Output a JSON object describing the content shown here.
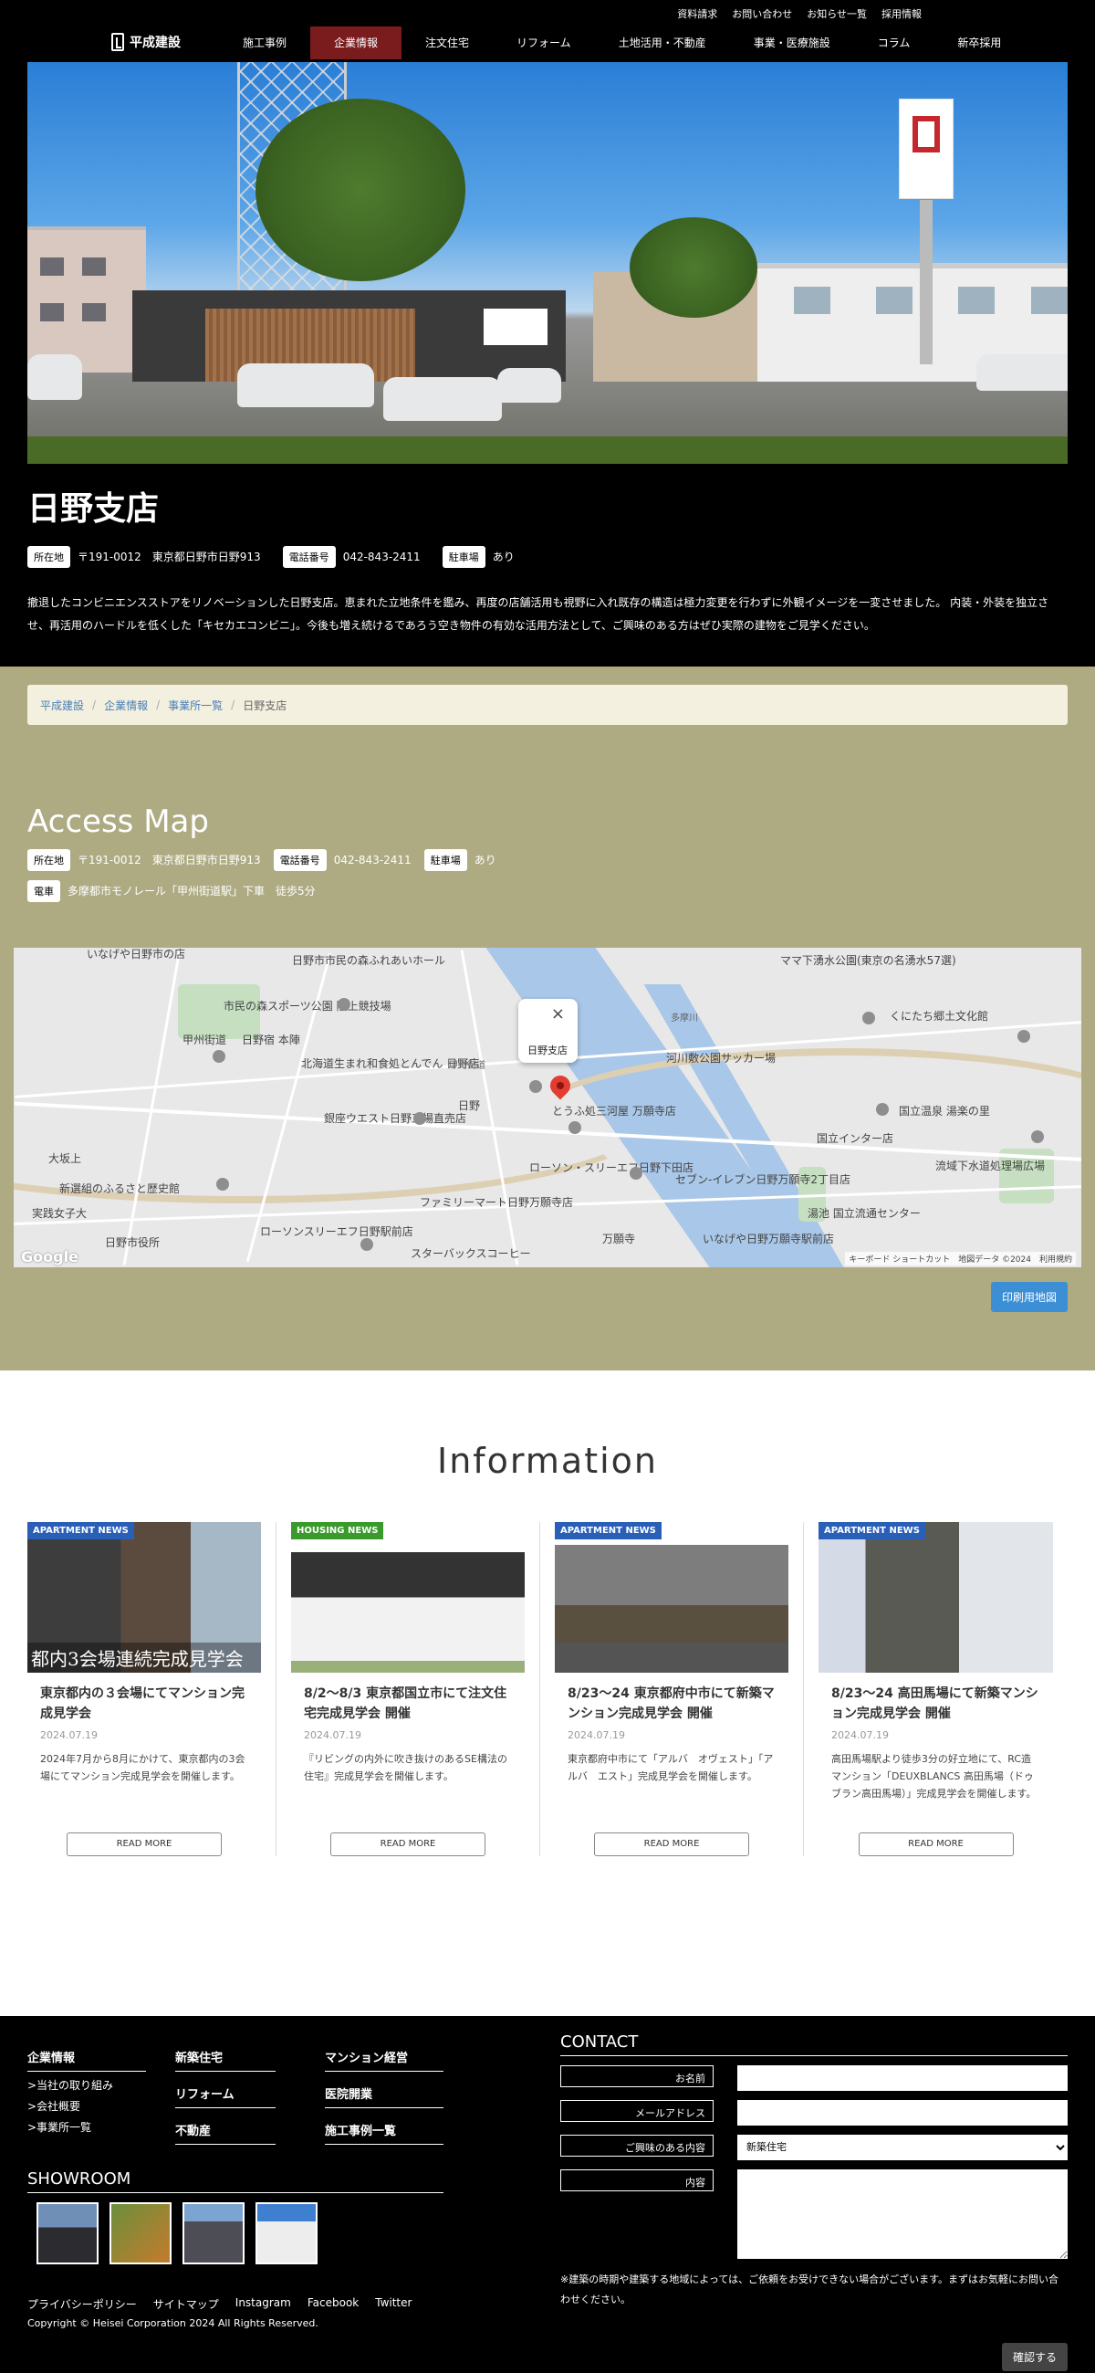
{
  "topbar": {
    "links": [
      "資料請求",
      "お問い合わせ",
      "お知らせ一覧",
      "採用情報"
    ]
  },
  "nav": {
    "logo": "平成建設",
    "items": [
      {
        "label": "施工事例",
        "active": false
      },
      {
        "label": "企業情報",
        "active": true
      },
      {
        "label": "注文住宅",
        "active": false
      },
      {
        "label": "リフォーム",
        "active": false
      },
      {
        "label": "土地活用・不動産",
        "active": false
      },
      {
        "label": "事業・医療施設",
        "active": false
      },
      {
        "label": "コラム",
        "active": false
      },
      {
        "label": "新卒採用",
        "active": false
      }
    ]
  },
  "hero": {
    "title": "日野支店",
    "address_tag": "所在地",
    "address": "〒191-0012　東京都日野市日野913",
    "phone_tag": "電話番号",
    "phone": "042-843-2411",
    "parking_tag": "駐車場",
    "parking": "あり",
    "description": "撤退したコンビニエンスストアをリノベーションした日野支店。恵まれた立地条件を鑑み、再度の店舗活用も視野に入れ既存の構造は極力変更を行わずに外観イメージを一変させました。 内装・外装を独立させ、再活用のハードルを低くした「キセカエコンビニ」。今後も増え続けるであろう空き物件の有効な活用方法として、ご興味のある方はぜひ実際の建物をご見学ください。"
  },
  "breadcrumb": [
    "平成建設",
    "企業情報",
    "事業所一覧",
    "日野支店"
  ],
  "access": {
    "title": "Access Map",
    "address_tag": "所在地",
    "address": "〒191-0012　東京都日野市日野913",
    "phone_tag": "電話番号",
    "phone": "042-843-2411",
    "parking_tag": "駐車場",
    "parking": "あり",
    "train_tag": "電車",
    "train": "多摩都市モノレール「甲州街道駅」下車　徒歩5分",
    "print_button": "印刷用地図"
  },
  "map": {
    "popup": "日野支店",
    "close": "×",
    "google": "Google",
    "footer": "キーボード ショートカット　地図データ ©2024　利用規約",
    "labels": [
      "いなげや日野市の店",
      "日野市市民の森ふれあいホール",
      "市民の森スポーツ公園 陸上競技場",
      "甲州街道",
      "日野宿 本陣",
      "北海道生まれ和食処とんでん 日野店",
      "日野",
      "銀座ウエスト日野工場直売店",
      "大坂上",
      "新選組のふるさと歴史館",
      "実践女子大",
      "日野市役所",
      "ローソンスリーエフ日野駅前店",
      "ファミリーマート日野万願寺店",
      "スターバックスコーヒー",
      "とうふ処三河屋 万願寺店",
      "ローソン・スリーエフ日野下田店",
      "セブン-イレブン日野万願寺2丁目店",
      "河川敷公園サッカー場",
      "ママ下湧水公園(東京の名湧水57選)",
      "くにたち郷土文化館",
      "国立温泉 湯楽の里",
      "流域下水道処理場広場",
      "国立インター店",
      "湯池 国立流通センター",
      "万願寺",
      "いなげや日野万願寺駅前店",
      "多摩川",
      "甲州街道"
    ]
  },
  "information": {
    "title": "Information",
    "read_more": "READ MORE",
    "cards": [
      {
        "badge": "APARTMENT NEWS",
        "badge_color": "#2a5fb8",
        "caption": "都内3会場連続完成見学会",
        "title": "東京都内の３会場にてマンション完成見学会",
        "date": "2024.07.19",
        "text": "2024年7月から8月にかけて、東京都内の3会場にてマンション完成見学会を開催します。"
      },
      {
        "badge": "HOUSING NEWS",
        "badge_color": "#3a9a2c",
        "caption": "",
        "title": "8/2～8/3 東京都国立市にて注文住宅完成見学会 開催",
        "date": "2024.07.19",
        "text": "『リビングの内外に吹き抜けのあるSE構法の住宅』完成見学会を開催します。"
      },
      {
        "badge": "APARTMENT NEWS",
        "badge_color": "#2a5fb8",
        "caption": "",
        "title": "8/23～24 東京都府中市にて新築マンション完成見学会 開催",
        "date": "2024.07.19",
        "text": "東京都府中市にて「アルバ　オヴェスト」「アルバ　エスト」完成見学会を開催します。"
      },
      {
        "badge": "APARTMENT NEWS",
        "badge_color": "#2a5fb8",
        "caption": "",
        "title": "8/23～24 高田馬場にて新築マンション完成見学会 開催",
        "date": "2024.07.19",
        "text": "高田馬場駅より徒歩3分の好立地にて、RC造マンション「DEUXBLANCS 高田馬場（ドゥブラン高田馬場）」完成見学会を開催します。"
      }
    ]
  },
  "footer": {
    "col1": {
      "head": "企業情報",
      "items": [
        ">当社の取り組み",
        ">会社概要",
        ">事業所一覧"
      ]
    },
    "col2": [
      "新築住宅",
      "リフォーム",
      "不動産"
    ],
    "col3": [
      "マンション経営",
      "医院開業",
      "施工事例一覧"
    ],
    "showroom": "SHOWROOM",
    "links": [
      "プライバシーポリシー",
      "サイトマップ",
      "Instagram",
      "Facebook",
      "Twitter"
    ],
    "copyright": "Copyright ©  Heisei Corporation 2024 All Rights Reserved.",
    "contact": {
      "title": "CONTACT",
      "name_label": "お名前",
      "email_label": "メールアドレス",
      "interest_label": "ご興味のある内容",
      "interest_value": "新築住宅",
      "content_label": "内容",
      "note": "※建築の時期や建築する地域によっては、ご依頼をお受けできない場合がございます。まずはお気軽にお問い合わせください。",
      "submit": "確認する"
    }
  }
}
